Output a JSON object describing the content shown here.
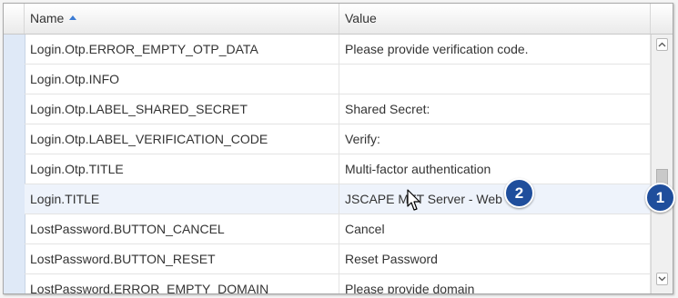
{
  "table": {
    "columns": {
      "name": "Name",
      "value": "Value"
    },
    "rows": [
      {
        "name": "Login.Otp.ERROR_EMPTY_OTP_DATA",
        "value": "Please provide verification code."
      },
      {
        "name": "Login.Otp.INFO",
        "value": ""
      },
      {
        "name": "Login.Otp.LABEL_SHARED_SECRET",
        "value": "Shared Secret:"
      },
      {
        "name": "Login.Otp.LABEL_VERIFICATION_CODE",
        "value": "Verify:"
      },
      {
        "name": "Login.Otp.TITLE",
        "value": "Multi-factor authentication"
      },
      {
        "name": "Login.TITLE",
        "value": "JSCAPE MFT Server - Web"
      },
      {
        "name": "LostPassword.BUTTON_CANCEL",
        "value": "Cancel"
      },
      {
        "name": "LostPassword.BUTTON_RESET",
        "value": "Reset Password"
      },
      {
        "name": "LostPassword.ERROR_EMPTY_DOMAIN",
        "value": "Please provide domain"
      }
    ]
  },
  "annotations": {
    "badge1": "1",
    "badge2": "2"
  },
  "colors": {
    "badge": "#1f4e9c",
    "sort_arrow": "#3b7bd4",
    "row_highlight": "#eef3fb"
  },
  "icons": {
    "sort": "sort-ascending-icon",
    "scroll_up": "chevron-up-icon",
    "scroll_down": "chevron-down-icon",
    "pointer": "mouse-pointer-icon"
  }
}
